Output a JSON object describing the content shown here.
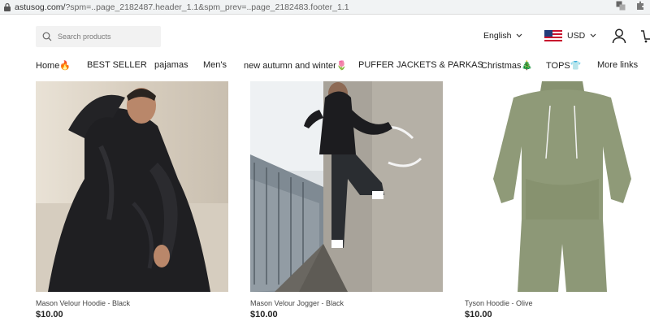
{
  "browser": {
    "url_host": "astusog.com/",
    "url_rest": "?spm=..page_2182487.header_1.1&spm_prev=..page_2182483.footer_1.1"
  },
  "header": {
    "search_placeholder": "Search products",
    "language": "English",
    "currency": "USD"
  },
  "nav": {
    "items": [
      {
        "label": "Home",
        "icon": "🔥"
      },
      {
        "label": "BEST SELLER"
      },
      {
        "label": "pajamas"
      },
      {
        "label": "Men's"
      },
      {
        "label": "new autumn and winter",
        "icon": "🌷"
      },
      {
        "label": "PUFFER JACKETS & PARKAS"
      },
      {
        "label": "Christmas",
        "icon": "🎄"
      },
      {
        "label": "TOPS",
        "icon": "👕"
      },
      {
        "label": "More links"
      }
    ]
  },
  "products": [
    {
      "title": "Mason Velour Hoodie - Black",
      "price": "$10.00"
    },
    {
      "title": "Mason Velour Jogger - Black",
      "price": "$10.00"
    },
    {
      "title": "Tyson Hoodie - Olive",
      "price": "$10.00"
    }
  ],
  "colors": {
    "olive": "#8f9a78",
    "black_velour": "#1c1c1e",
    "accent": "#222222"
  }
}
